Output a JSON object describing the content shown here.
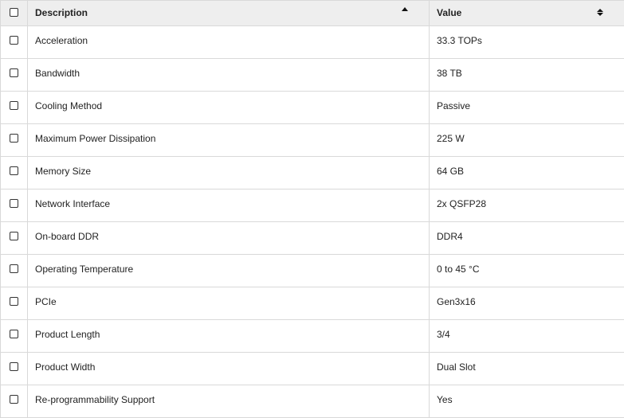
{
  "table": {
    "headers": {
      "description": "Description",
      "value": "Value"
    },
    "sort": {
      "description": "ascending",
      "value": "unsorted"
    },
    "rows": [
      {
        "description": "Acceleration",
        "value": "33.3 TOPs"
      },
      {
        "description": "Bandwidth",
        "value": "38 TB"
      },
      {
        "description": "Cooling Method",
        "value": "Passive"
      },
      {
        "description": "Maximum Power Dissipation",
        "value": "225 W"
      },
      {
        "description": "Memory Size",
        "value": "64 GB"
      },
      {
        "description": "Network Interface",
        "value": "2x QSFP28"
      },
      {
        "description": "On-board DDR",
        "value": "DDR4"
      },
      {
        "description": "Operating Temperature",
        "value": "0 to 45 °C"
      },
      {
        "description": "PCIe",
        "value": "Gen3x16"
      },
      {
        "description": "Product Length",
        "value": "3/4"
      },
      {
        "description": "Product Width",
        "value": "Dual Slot"
      },
      {
        "description": "Re-programmability Support",
        "value": "Yes"
      }
    ]
  },
  "colors": {
    "header_background": "#eeeeee",
    "border": "#d9d9d9",
    "text": "#222222"
  },
  "icons": {
    "description_sort": "sort-ascending-icon",
    "value_sort": "sort-both-icon",
    "checkbox": "checkbox"
  }
}
